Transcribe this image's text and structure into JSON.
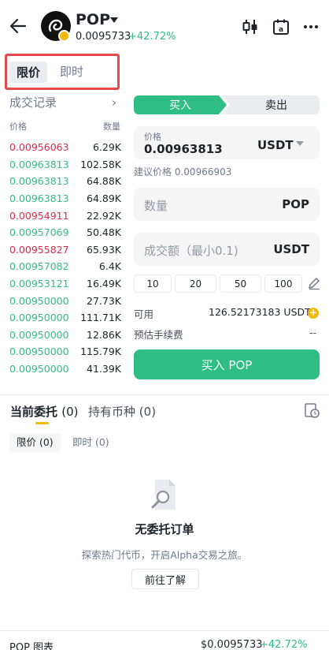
{
  "header": {
    "pair": "POP",
    "price": "0.0095733",
    "change": "+42.72%"
  },
  "order_type_tabs": [
    "限价",
    "即时"
  ],
  "trades": {
    "title": "成交记录",
    "col_price": "价格",
    "col_qty": "数量",
    "rows": [
      {
        "price": "0.00956063",
        "qty": "6.29K",
        "side": "sell"
      },
      {
        "price": "0.00963813",
        "qty": "102.58K",
        "side": "buy"
      },
      {
        "price": "0.00963813",
        "qty": "64.88K",
        "side": "buy"
      },
      {
        "price": "0.00963813",
        "qty": "64.89K",
        "side": "buy"
      },
      {
        "price": "0.00954911",
        "qty": "22.92K",
        "side": "sell"
      },
      {
        "price": "0.00957069",
        "qty": "50.48K",
        "side": "buy"
      },
      {
        "price": "0.00955827",
        "qty": "65.93K",
        "side": "sell"
      },
      {
        "price": "0.00957082",
        "qty": "6.4K",
        "side": "buy"
      },
      {
        "price": "0.00953121",
        "qty": "16.49K",
        "side": "buy"
      },
      {
        "price": "0.00950000",
        "qty": "27.73K",
        "side": "buy"
      },
      {
        "price": "0.00950000",
        "qty": "111.71K",
        "side": "buy"
      },
      {
        "price": "0.00950000",
        "qty": "12.86K",
        "side": "buy"
      },
      {
        "price": "0.00950000",
        "qty": "115.79K",
        "side": "buy"
      },
      {
        "price": "0.00950000",
        "qty": "41.39K",
        "side": "buy"
      }
    ]
  },
  "trade_form": {
    "buy_label": "买入",
    "sell_label": "卖出",
    "price_label": "价格",
    "price_value": "0.00963813",
    "price_unit": "USDT",
    "suggested_label": "建议价格",
    "suggested_value": "0.00966903",
    "qty_placeholder": "数量",
    "qty_unit": "POP",
    "amount_placeholder": "成交额（最小0.1)",
    "amount_unit": "USDT",
    "quick_amounts": [
      "10",
      "20",
      "50",
      "100"
    ],
    "available_label": "可用",
    "available_value": "126.52173183 USDT",
    "fee_label": "预估手续费",
    "fee_value": "--",
    "submit_label": "买入 POP"
  },
  "orders": {
    "tab_open": "当前委托",
    "tab_open_count": "(0)",
    "tab_holdings": "持有币种",
    "tab_holdings_count": "(0)",
    "sub_limit": "限价 (0)",
    "sub_market": "即时 (0)",
    "empty_title": "无委托订单",
    "empty_sub": "探索热门代币，开启Alpha交易之旅。",
    "empty_button": "前往了解"
  },
  "footer": {
    "name": "POP 图表",
    "price": "$0.0095733",
    "change": "+42.72%"
  },
  "colors": {
    "green": "#2ebd85",
    "red": "#e0294a",
    "accent_yellow": "#f0b90b",
    "highlight_box": "#e8494c"
  }
}
